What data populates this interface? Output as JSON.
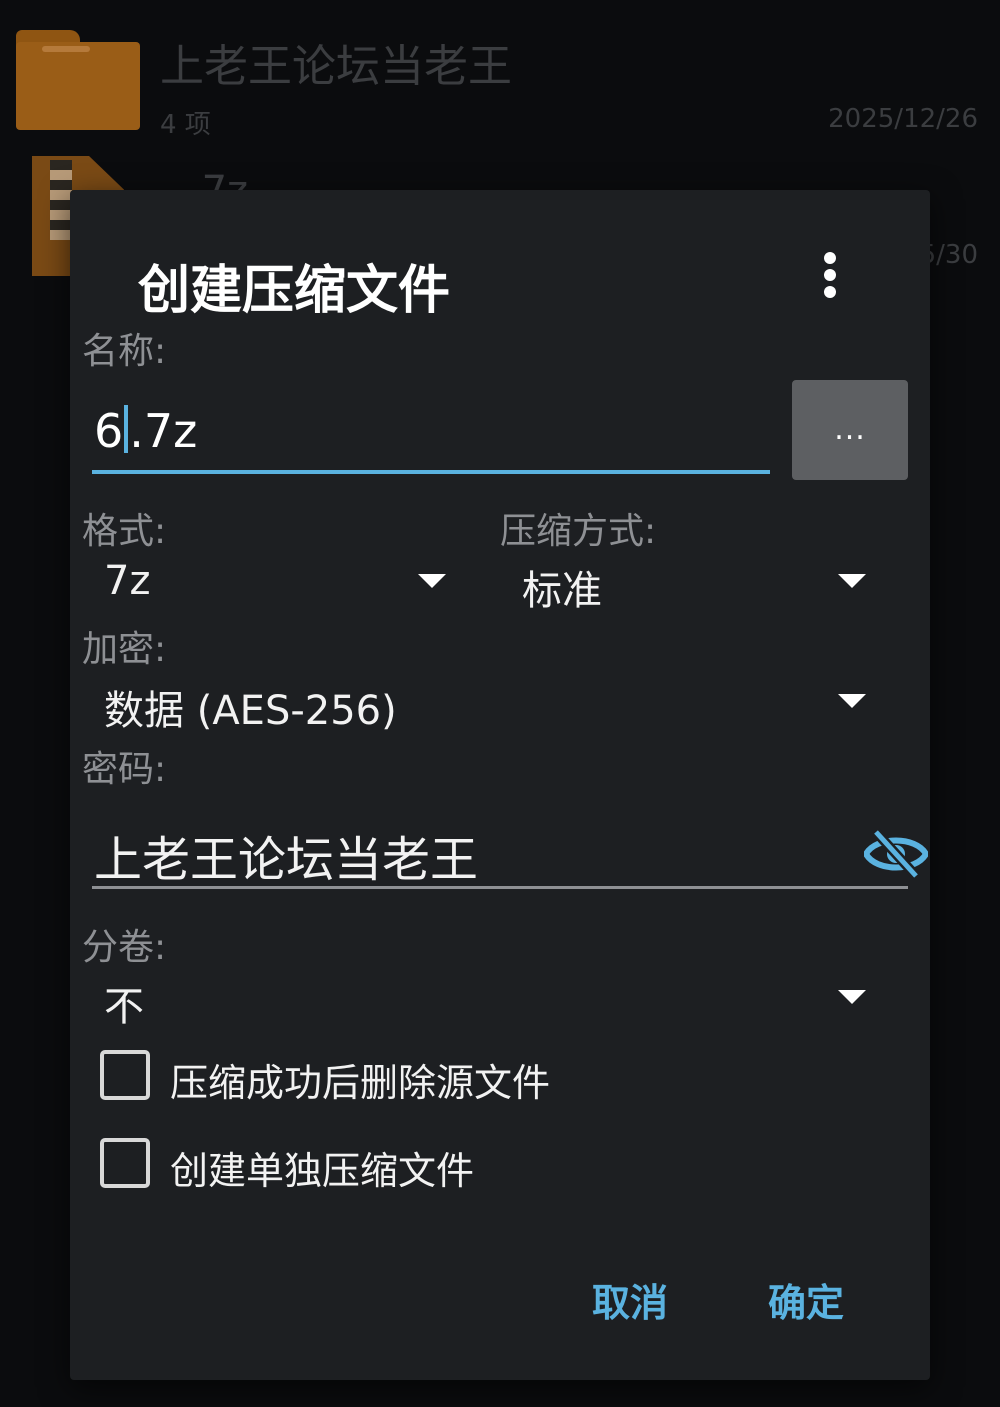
{
  "background_list": {
    "folder": {
      "name": "上老王论坛当老王",
      "count": "4 项",
      "date": "2025/12/26"
    },
    "archive": {
      "name": "-- 7z",
      "date_partial": "5/30"
    }
  },
  "dialog": {
    "title": "创建压缩文件",
    "name_label": "名称:",
    "name_value_before_caret": "6",
    "name_value_after_caret": ".7z",
    "browse_label": "...",
    "format_label": "格式:",
    "format_value": "7z",
    "compression_label": "压缩方式:",
    "compression_value": "标准",
    "encryption_label": "加密:",
    "encryption_value": "数据 (AES-256)",
    "password_label": "密码:",
    "password_value": "上老王论坛当老王",
    "split_label": "分卷:",
    "split_value": "不",
    "delete_source_label": "压缩成功后删除源文件",
    "delete_source_checked": false,
    "separate_archives_label": "创建单独压缩文件",
    "separate_archives_checked": false,
    "cancel_label": "取消",
    "ok_label": "确定"
  },
  "colors": {
    "accent": "#5ab2e0",
    "dialog_bg": "#1d1f22",
    "screen_bg": "#0b0c0e",
    "label_gray": "#8e9094",
    "folder_brown": "#9a5d17"
  },
  "icons": {
    "more": "more-vertical-icon",
    "password_visibility": "eye-off-icon",
    "folder": "folder-icon",
    "archive": "archive-file-icon",
    "dropdown": "dropdown-arrow-icon"
  }
}
